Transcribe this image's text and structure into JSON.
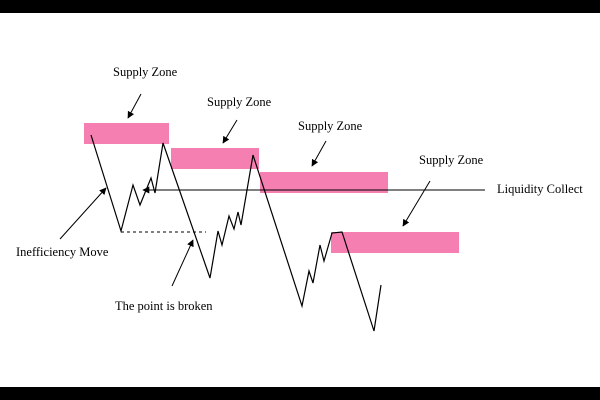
{
  "diagram": {
    "supply_zone_label": "Supply Zone",
    "liquidity_label": "Liquidity Collect",
    "inefficiency_label": "Inefficiency Move",
    "break_label": "The point is broken",
    "zone_color": "#f67fb2",
    "line_color": "#000000",
    "background": "#ffffff",
    "frame_color": "#000000"
  }
}
